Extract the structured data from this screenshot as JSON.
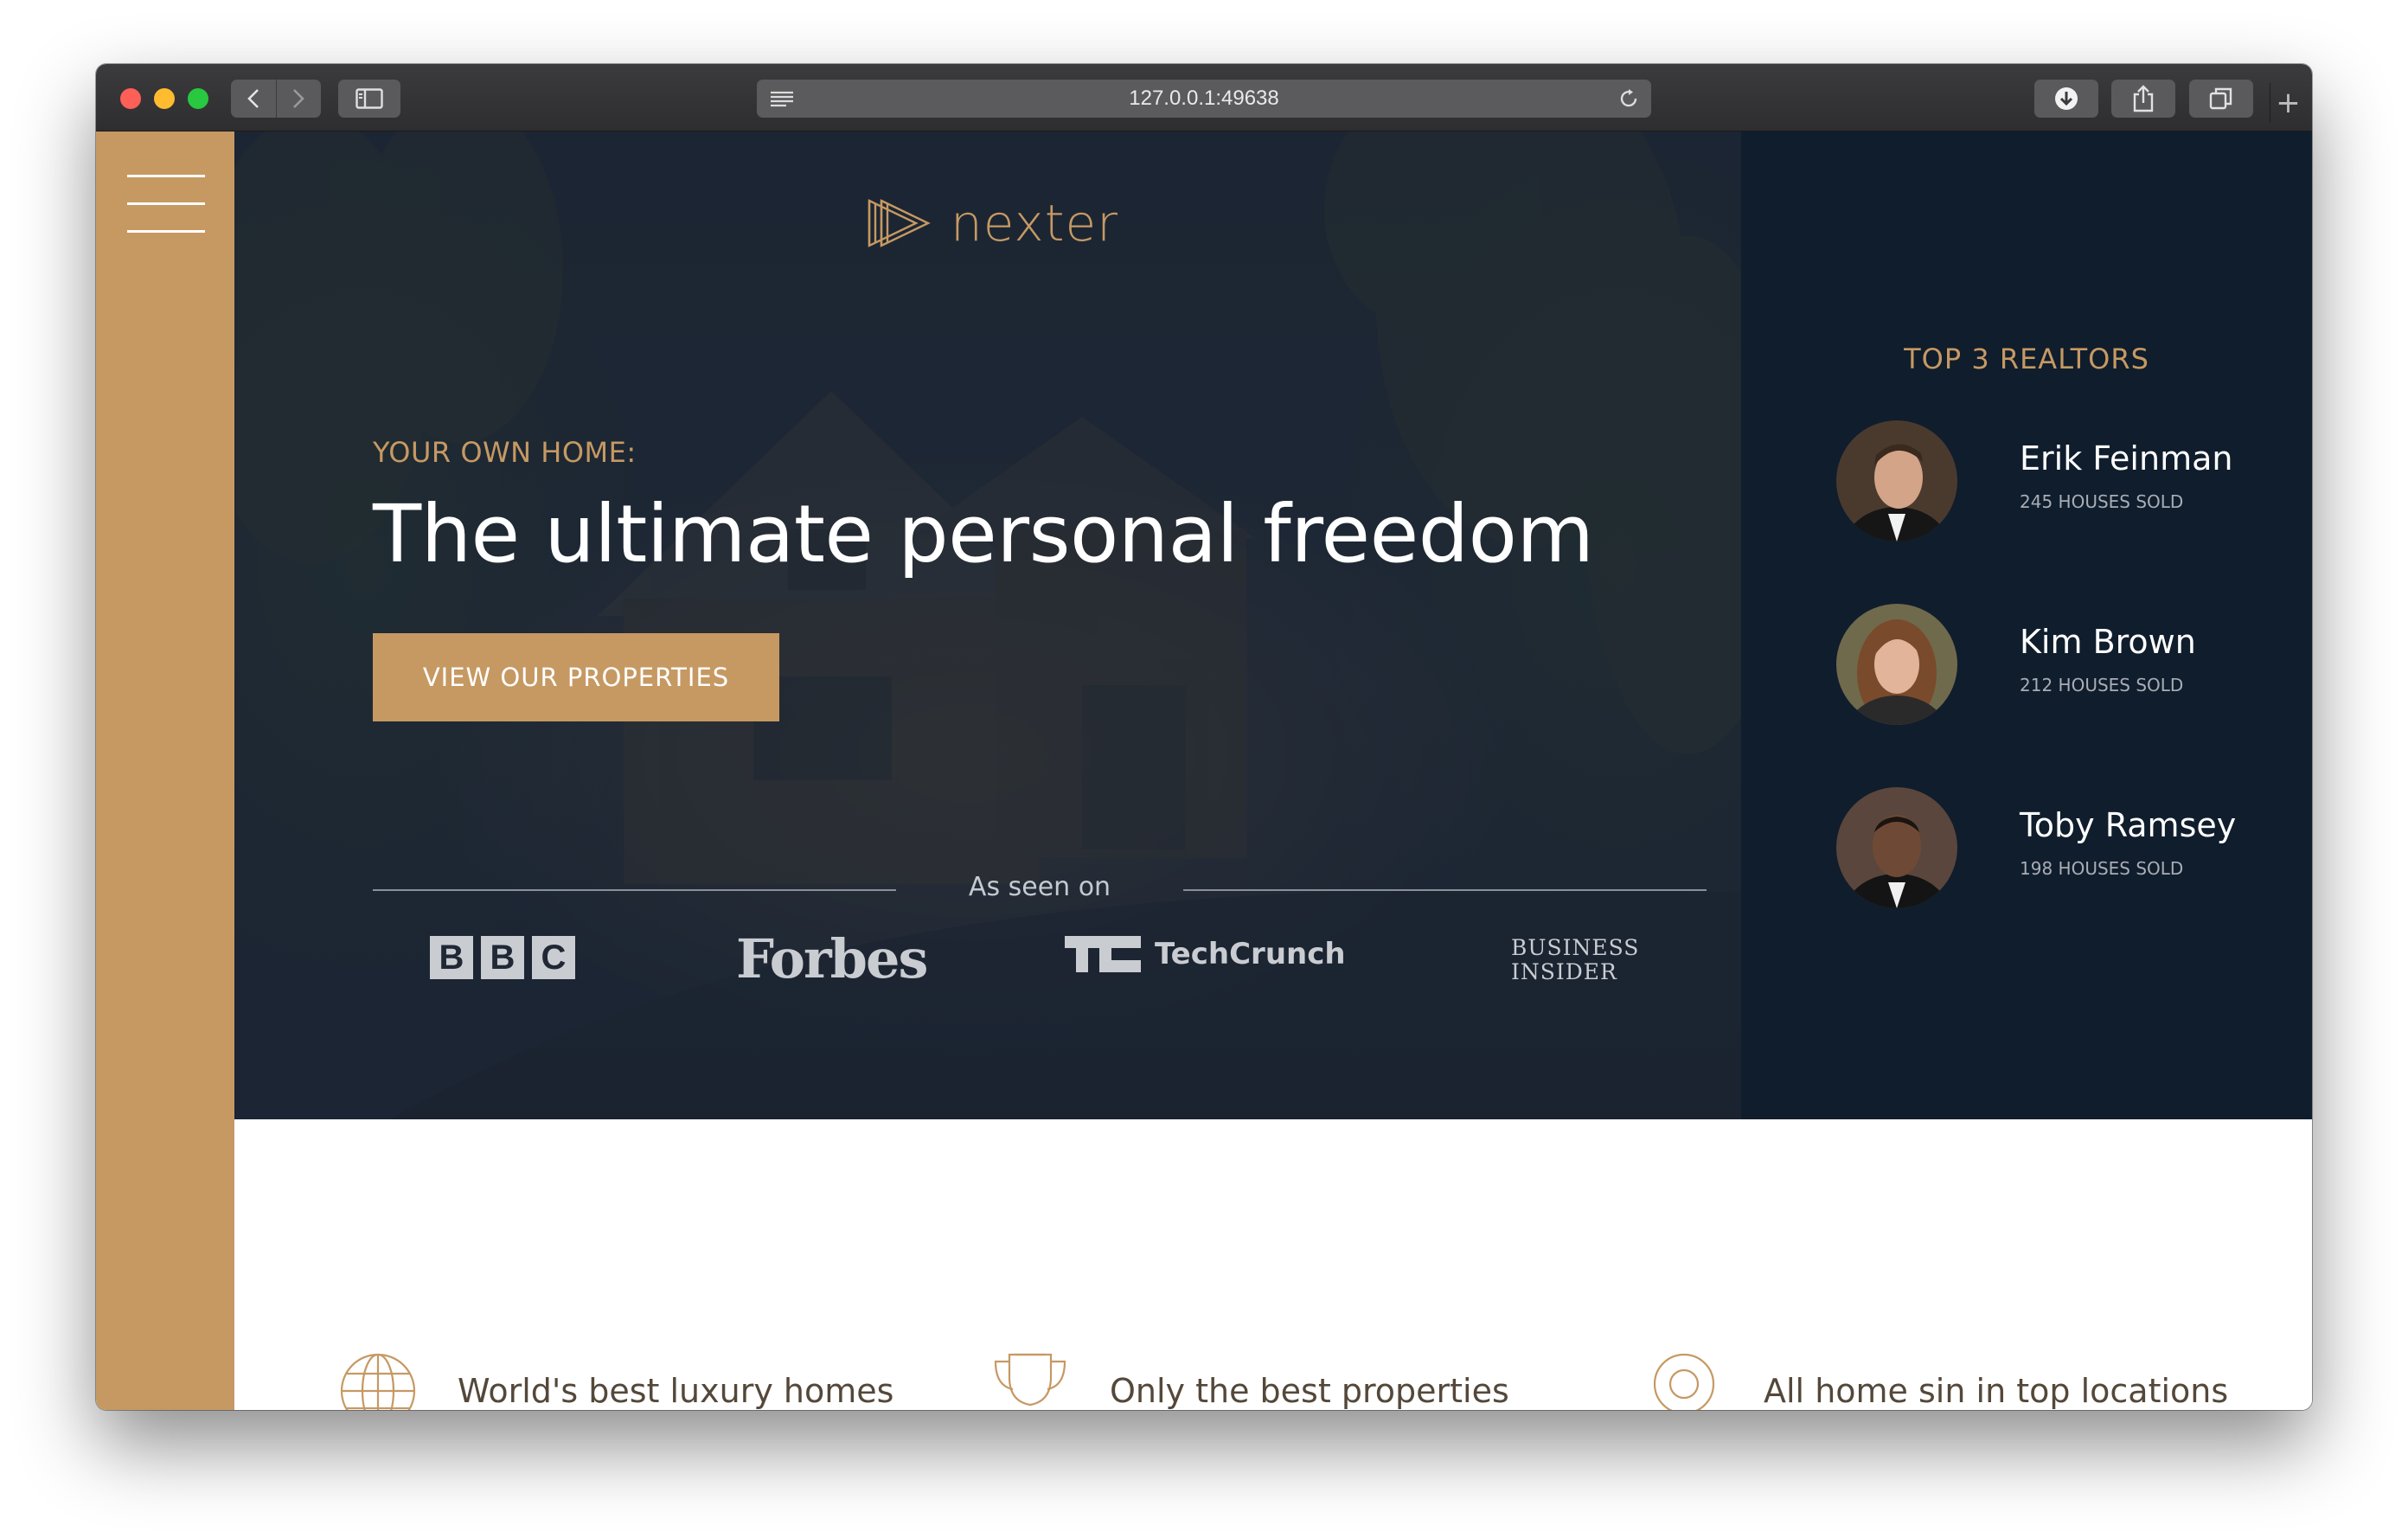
{
  "browser": {
    "url": "127.0.0.1:49638",
    "new_tab_symbol": "+"
  },
  "brand": {
    "logo_text": "nexter",
    "accent_color": "#c69963",
    "dark_color": "#101d2c"
  },
  "hero": {
    "sub_heading": "YOUR OWN HOME:",
    "title": "The ultimate personal freedom",
    "cta_label": "VIEW OUR PROPERTIES",
    "seen_on_label": "As seen on",
    "press": {
      "bbc": [
        "B",
        "B",
        "C"
      ],
      "forbes": "Forbes",
      "techcrunch": "TechCrunch",
      "business_insider_line1": "BUSINESS",
      "business_insider_line2": "INSIDER"
    }
  },
  "realtors": {
    "title": "TOP 3 REALTORS",
    "items": [
      {
        "name": "Erik Feinman",
        "sold": "245 HOUSES SOLD"
      },
      {
        "name": "Kim Brown",
        "sold": "212 HOUSES SOLD"
      },
      {
        "name": "Toby Ramsey",
        "sold": "198 HOUSES SOLD"
      }
    ]
  },
  "features": [
    {
      "icon": "globe-icon",
      "title": "World's best luxury homes"
    },
    {
      "icon": "trophy-icon",
      "title": "Only the best properties"
    },
    {
      "icon": "map-pin-icon",
      "title": "All home sin in top locations"
    }
  ]
}
